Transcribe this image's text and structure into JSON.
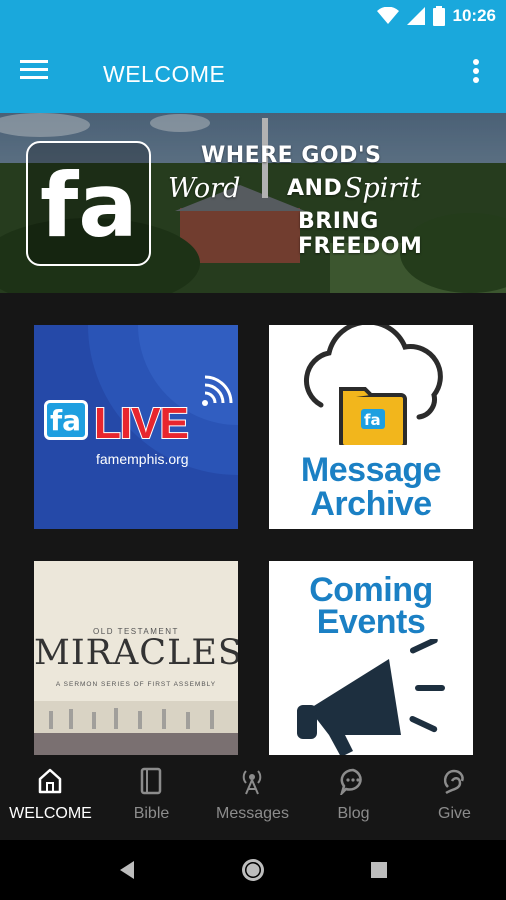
{
  "status_bar": {
    "time": "10:26",
    "icons": [
      "wifi-icon",
      "signal-icon",
      "battery-icon"
    ]
  },
  "app_bar": {
    "title": "WELCOME",
    "color": "#1aa8dc"
  },
  "banner": {
    "logo": "fa",
    "tagline_line1": "WHERE GOD'S",
    "tagline_word": "Word",
    "tagline_and": "AND",
    "tagline_spirit": "Spirit",
    "tagline_line3": "BRING FREEDOM"
  },
  "tiles": {
    "live": {
      "logo": "fa",
      "title": "LIVE",
      "url": "famemphis.org"
    },
    "archive": {
      "line1": "Message",
      "line2": "Archive"
    },
    "miracles": {
      "subtitle": "OLD TESTAMENT",
      "title": "MIRACLES",
      "series": "A SERMON SERIES OF FIRST ASSEMBLY"
    },
    "events": {
      "line1": "Coming",
      "line2": "Events"
    }
  },
  "bottom_nav": [
    {
      "label": "WELCOME",
      "icon": "home-icon",
      "active": true
    },
    {
      "label": "Bible",
      "icon": "book-icon",
      "active": false
    },
    {
      "label": "Messages",
      "icon": "broadcast-icon",
      "active": false
    },
    {
      "label": "Blog",
      "icon": "chat-bubble-icon",
      "active": false
    },
    {
      "label": "Give",
      "icon": "give-icon",
      "active": false
    }
  ],
  "colors": {
    "accent": "#1aa8dc",
    "brand_blue": "#1b80c4",
    "live_red": "#e8262e"
  }
}
